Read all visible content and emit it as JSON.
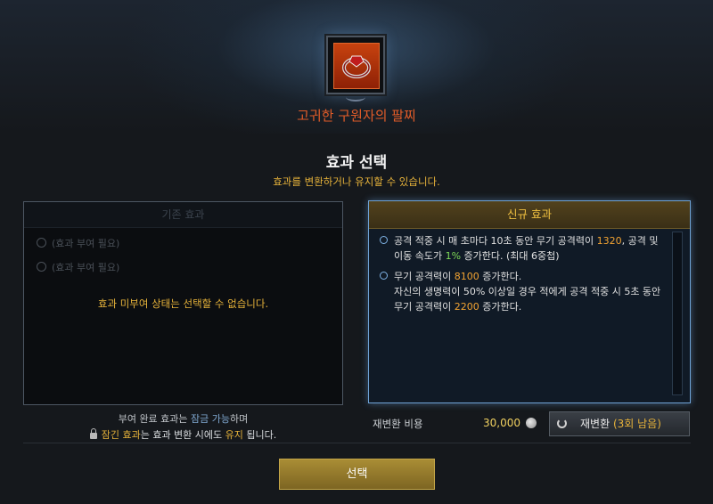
{
  "item": {
    "name": "고귀한 구원자의 팔찌",
    "icon": "bracelet-icon"
  },
  "section": {
    "title": "효과 선택",
    "subtitle": "효과를 변환하거나 유지할 수 있습니다."
  },
  "left_panel": {
    "title": "기존 효과",
    "placeholders": [
      "(효과 부여 필요)",
      "(효과 부여 필요)"
    ],
    "message": "효과 미부여 상태는 선택할 수 없습니다.",
    "note_line1_a": "부여 완료 효과는",
    "note_line1_b": "잠금 가능",
    "note_line1_c": "하며",
    "note_line2_a": "잠긴 효과",
    "note_line2_b": "는 효과 변환 시에도",
    "note_line2_c": "유지",
    "note_line2_d": "됩니다."
  },
  "right_panel": {
    "title": "신규 효과",
    "effects": [
      {
        "p1": "공격 적중 시 매 초마다 10초 동안 무기 공격력이 ",
        "v1": "1320",
        "p2": ", 공격 및 이동 속도가 ",
        "v2": "1%",
        "p3": " 증가한다. (최대 6중첩)"
      },
      {
        "p1": "무기 공격력이 ",
        "v1": "8100",
        "p2": " 증가한다.",
        "p3": "자신의 생명력이 50% 이상일 경우 적에게 공격 적중 시 5초 동안 무기 공격력이 ",
        "v2": "2200",
        "p4": " 증가한다."
      }
    ]
  },
  "cost": {
    "label": "재변환 비용",
    "value": "30,000",
    "icon": "silver-coin-icon"
  },
  "reroll": {
    "label": "재변환",
    "remaining": "(3회 남음)"
  },
  "select_button": "선택",
  "colors": {
    "accent_gold": "#e6b23a",
    "item_name": "#e25c28",
    "value_orange": "#f2a332",
    "value_green": "#7ed957",
    "panel_border": "#6fa3d6"
  }
}
